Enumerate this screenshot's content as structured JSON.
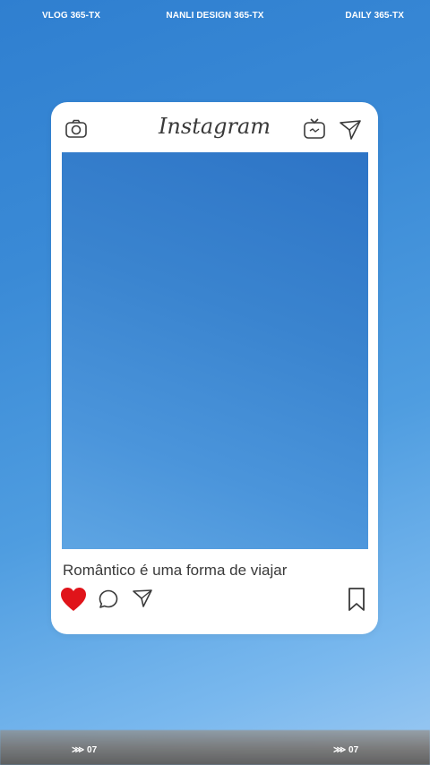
{
  "header": {
    "left": "VLOG 365-TX",
    "center": "NANLI DESIGN 365-TX",
    "right": "DAILY 365-TX"
  },
  "post": {
    "app_logo": "Instagram",
    "caption": "Romântico é uma forma de viajar",
    "liked": true,
    "like_color": "#e0141a"
  },
  "icons": {
    "camera": "camera-icon",
    "igtv": "igtv-icon",
    "send": "send-icon",
    "heart": "heart-icon",
    "comment": "comment-icon",
    "share": "share-icon",
    "bookmark": "bookmark-icon"
  },
  "footer": {
    "left": "⋙ 07",
    "right": "⋙ 07"
  }
}
